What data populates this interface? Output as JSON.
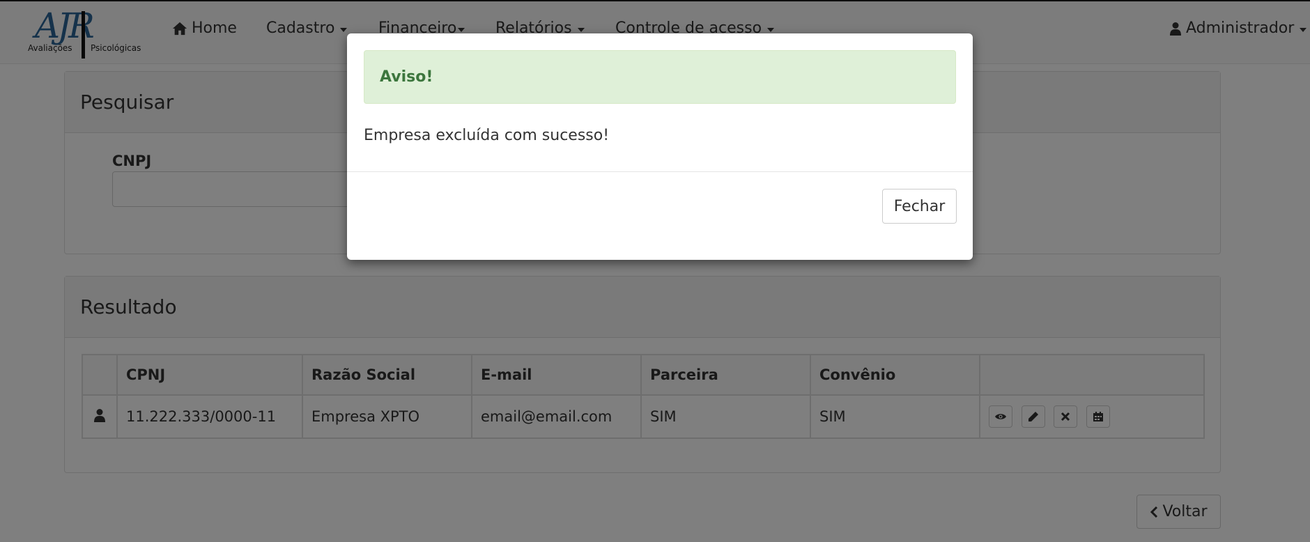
{
  "brand": {
    "mark": "AJR",
    "left_text": "Avaliações",
    "right_text": "Psicológicas"
  },
  "nav": {
    "home": "Home",
    "cadastro": "Cadastro",
    "financeiro": "Financeiro",
    "relatorios": "Relatórios",
    "controle": "Controle de acesso",
    "user": "Administrador"
  },
  "search_panel": {
    "title": "Pesquisar",
    "cnpj_label": "CNPJ",
    "cnpj_value": ""
  },
  "result_panel": {
    "title": "Resultado",
    "columns": [
      "CPNJ",
      "Razão Social",
      "E-mail",
      "Parceira",
      "Convênio"
    ],
    "rows": [
      {
        "cnpj": "11.222.333/0000-11",
        "razao": "Empresa XPTO",
        "email": "email@email.com",
        "parceira": "SIM",
        "convenio": "SIM"
      }
    ],
    "row_actions": [
      "eye-icon",
      "pencil-icon",
      "remove-icon",
      "calendar-icon"
    ]
  },
  "back_button": "Voltar",
  "modal": {
    "alert_title": "Aviso!",
    "message": "Empresa excluída com sucesso!",
    "close_button": "Fechar"
  },
  "colors": {
    "alert_bg": "#dff0d8",
    "alert_text": "#3c763d",
    "logo_blue": "#2a6496",
    "backdrop": "rgba(0,0,0,0.5)"
  }
}
